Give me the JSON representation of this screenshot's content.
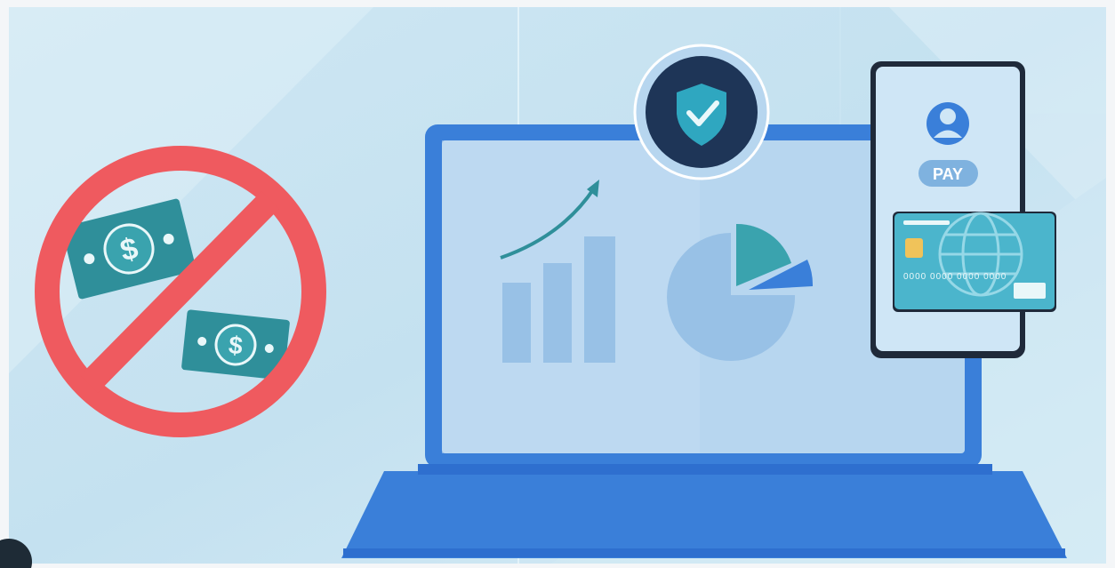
{
  "illustration": {
    "palette": {
      "background_light": "#d9edf7",
      "background_mid": "#c5e2f1",
      "prohibit_red": "#ef5a5f",
      "cash_teal": "#2f8f9a",
      "laptop_blue": "#3a7fd9",
      "laptop_dark": "#2e6fcf",
      "screen_blue": "#b7d6ef",
      "shield_navy": "#1e3557",
      "shield_teal": "#2fa7c0",
      "card_teal": "#4bb5cc",
      "chip_gold": "#f0c35a",
      "phone_bg": "#cfe6f6",
      "phone_outline": "#1f2a3a"
    },
    "icons": [
      "no-cash-icon",
      "dollar-bill-icon",
      "laptop-icon",
      "bar-chart-icon",
      "trend-arrow-icon",
      "pie-chart-icon",
      "security-shield-check-icon",
      "smartphone-icon",
      "user-avatar-icon",
      "credit-card-icon",
      "globe-icon",
      "card-chip-icon"
    ],
    "phone": {
      "pay_label": "PAY"
    },
    "card": {
      "number_text": "0000 0000 0000 0000"
    },
    "bill": {
      "symbol": "$"
    }
  }
}
